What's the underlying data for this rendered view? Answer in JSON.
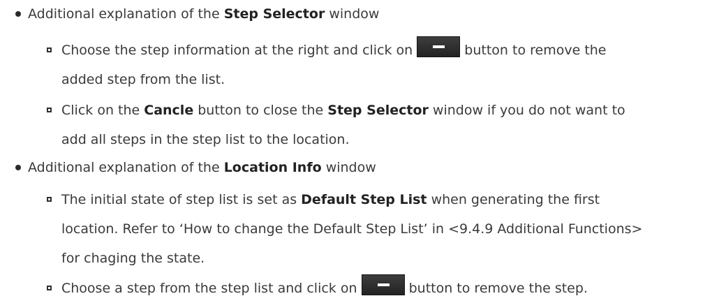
{
  "bullets": [
    {
      "intro": "Additional explanation of the ",
      "bold": "Step Selector",
      "outro": " window",
      "subs": [
        {
          "line1_pre": "Choose the step information at the right and click on ",
          "button_icon": "minus-icon",
          "line1_post": " button to remove the",
          "line2": "added step from the list."
        },
        {
          "line1_pre": "Click on the ",
          "bold1": "Cancle",
          "line1_mid": " button to close the ",
          "bold2": "Step Selector",
          "line1_post": " window if you do not want to",
          "line2": "add all steps in the step list to the location."
        }
      ]
    },
    {
      "intro": "Additional explanation of the ",
      "bold": "Location Info",
      "outro": " window",
      "subs": [
        {
          "line1_pre": "The initial state of step list is set as ",
          "bold1": "Default Step List",
          "line1_post": " when generating the first",
          "line2": "location. Refer to ‘How to change the Default Step List’ in <9.4.9 Additional Functions>",
          "line3": "for chaging the state."
        },
        {
          "line1_pre": "Choose a step from the step list and click on ",
          "button_icon": "minus-icon",
          "line1_post": " button to remove the step."
        }
      ]
    }
  ]
}
